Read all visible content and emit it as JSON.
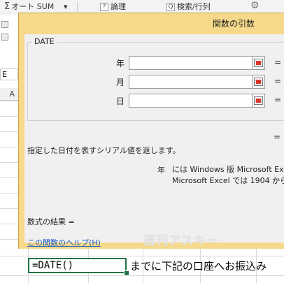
{
  "ribbon": {
    "autosum_label": "オート SUM",
    "logic_label": "論理",
    "lookup_label": "検索/行列"
  },
  "namebox": {
    "value": "E"
  },
  "column_header": {
    "label": "A"
  },
  "dialog": {
    "title": "関数の引数",
    "function_name": "DATE",
    "args": [
      {
        "label": "年",
        "value": "",
        "equals": "="
      },
      {
        "label": "月",
        "value": "",
        "equals": "="
      },
      {
        "label": "日",
        "value": "",
        "equals": "="
      }
    ],
    "equals_mid": "=",
    "description": "指定した日付を表すシリアル値を返します。",
    "arg_desc_name": "年",
    "arg_desc_text": "には Windows 版 Microsoft Ex\nMicrosoft Excel では 1904 から",
    "result_label": "数式の結果 =",
    "help_link": "この関数のヘルプ(H)"
  },
  "cell": {
    "formula": "=DATE()",
    "adjacent_text": "までに下記の口座へお振込み"
  },
  "watermark": {
    "text": "週刊アスキー"
  },
  "colors": {
    "dialog_frame": "#f6d98a",
    "client_bg": "#f0f0f0",
    "link": "#1a58c4",
    "active_cell_border": "#217346"
  }
}
